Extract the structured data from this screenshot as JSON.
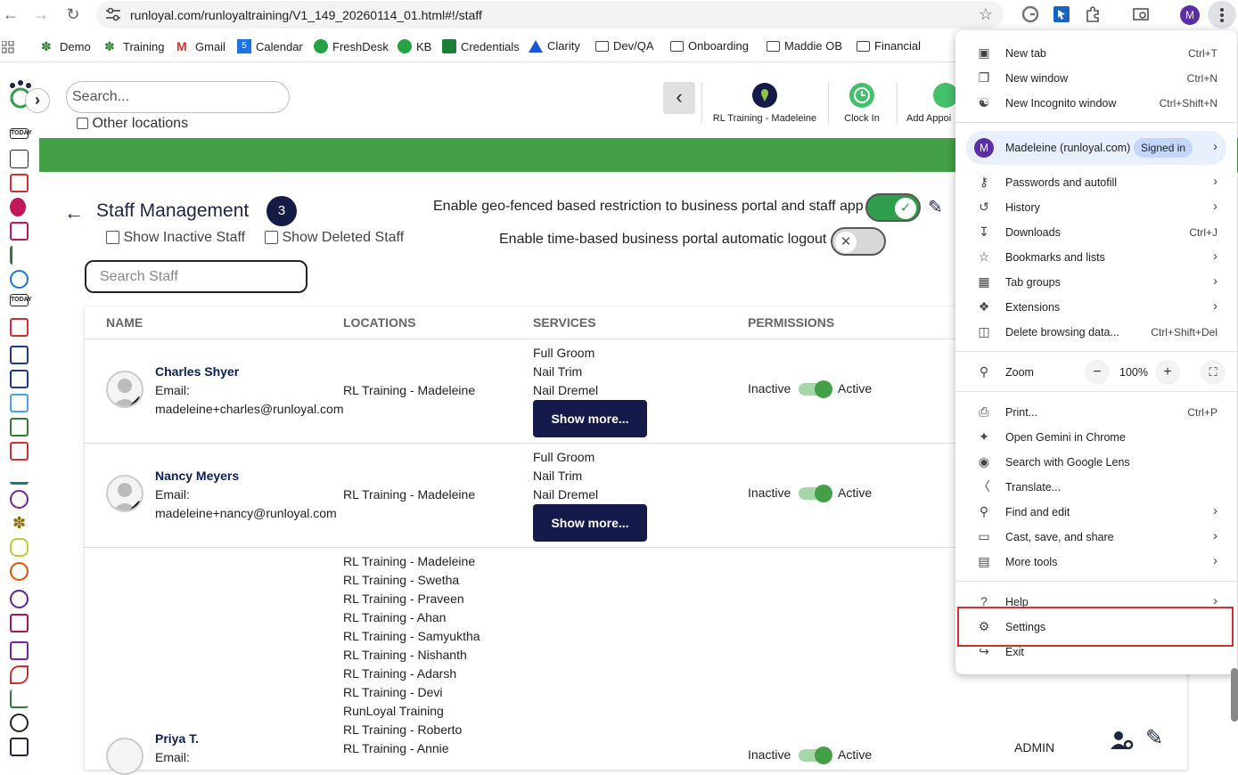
{
  "browser": {
    "url": "runloyal.com/runloyaltraining/V1_149_20260114_01.html#!/staff",
    "profile_initial": "M",
    "bookmarks": [
      "Demo",
      "Training",
      "Gmail",
      "Calendar",
      "FreshDesk",
      "KB",
      "Credentials",
      "Clarity",
      "Dev/QA",
      "Onboarding",
      "Maddie OB",
      "Financial"
    ]
  },
  "app": {
    "search_placeholder": "Search...",
    "other_locations": "Other locations",
    "top_tiles": {
      "location": "RL Training - Madeleine",
      "clock_in": "Clock In",
      "add_appointment": "Add Appoi"
    },
    "page_title": "Staff Management",
    "staff_count": "3",
    "show_inactive": "Show Inactive Staff",
    "show_deleted": "Show Deleted Staff",
    "geo_label": "Enable geo-fenced based restriction to business portal and staff app",
    "time_label": "Enable time-based business portal automatic logout",
    "staff_search_placeholder": "Search Staff",
    "columns": [
      "NAME",
      "LOCATIONS",
      "SERVICES",
      "PERMISSIONS"
    ],
    "rows": [
      {
        "name": "Charles Shyer",
        "email_label": "Email:",
        "email": "madeleine+charles@runloyal.com",
        "location": "RL Training - Madeleine",
        "services": [
          "Full Groom",
          "Nail Trim",
          "Nail Dremel"
        ],
        "show_more": "Show more...",
        "inactive": "Inactive",
        "active": "Active"
      },
      {
        "name": "Nancy Meyers",
        "email_label": "Email:",
        "email": "madeleine+nancy@runloyal.com",
        "location": "RL Training - Madeleine",
        "services": [
          "Full Groom",
          "Nail Trim",
          "Nail Dremel"
        ],
        "show_more": "Show more...",
        "inactive": "Inactive",
        "active": "Active"
      },
      {
        "name": "Priya T.",
        "email_label": "Email:",
        "locations": [
          "RL Training - Madeleine",
          "RL Training - Swetha",
          "RL Training - Praveen",
          "RL Training - Ahan",
          "RL Training - Samyuktha",
          "RL Training - Nishanth",
          "RL Training - Adarsh",
          "RL Training - Devi",
          "RunLoyal Training",
          "RL Training - Roberto",
          "RL Training - Annie"
        ],
        "inactive": "Inactive",
        "active": "Active",
        "role": "ADMIN"
      }
    ]
  },
  "menu": {
    "new_tab": {
      "label": "New tab",
      "shortcut": "Ctrl+T"
    },
    "new_window": {
      "label": "New window",
      "shortcut": "Ctrl+N"
    },
    "incognito": {
      "label": "New Incognito window",
      "shortcut": "Ctrl+Shift+N"
    },
    "profile_name": "Madeleine (runloyal.com)",
    "signed_in": "Signed in",
    "passwords": "Passwords and autofill",
    "history": "History",
    "downloads": {
      "label": "Downloads",
      "shortcut": "Ctrl+J"
    },
    "bookmarks": "Bookmarks and lists",
    "tab_groups": "Tab groups",
    "extensions": "Extensions",
    "delete_data": {
      "label": "Delete browsing data...",
      "shortcut": "Ctrl+Shift+Del"
    },
    "zoom": {
      "label": "Zoom",
      "value": "100%"
    },
    "print": {
      "label": "Print...",
      "shortcut": "Ctrl+P"
    },
    "gemini": "Open Gemini in Chrome",
    "lens": "Search with Google Lens",
    "translate": "Translate...",
    "find_edit": "Find and edit",
    "cast": "Cast, save, and share",
    "more_tools": "More tools",
    "help": "Help",
    "settings": "Settings",
    "exit": "Exit"
  },
  "colors": {
    "green_bar": "#43a047",
    "navy": "#141a4a",
    "highlight": "#d32f2f"
  }
}
